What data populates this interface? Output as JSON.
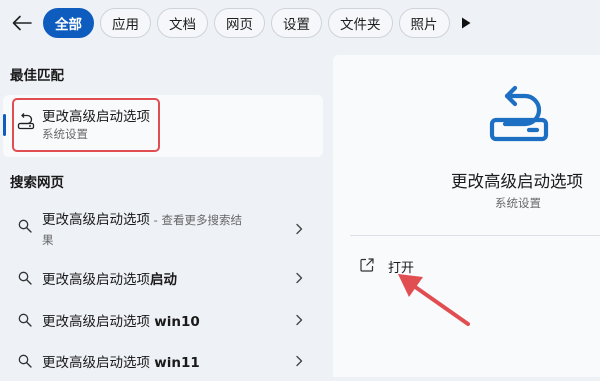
{
  "topbar": {
    "chips": [
      {
        "label": "全部",
        "active": true
      },
      {
        "label": "应用",
        "active": false
      },
      {
        "label": "文档",
        "active": false
      },
      {
        "label": "网页",
        "active": false
      },
      {
        "label": "设置",
        "active": false
      },
      {
        "label": "文件夹",
        "active": false
      },
      {
        "label": "照片",
        "active": false
      }
    ]
  },
  "best_match": {
    "heading": "最佳匹配",
    "title": "更改高级启动选项",
    "subtitle": "系统设置"
  },
  "web_search": {
    "heading": "搜索网页",
    "items": [
      {
        "label": "更改高级启动选项",
        "suffix": " - 查看更多搜索结",
        "wrap": "果"
      },
      {
        "label": "更改高级启动选项",
        "bold": "启动"
      },
      {
        "label": "更改高级启动选项 ",
        "bold": "win10"
      },
      {
        "label": "更改高级启动选项 ",
        "bold": "win11"
      }
    ]
  },
  "detail": {
    "title": "更改高级启动选项",
    "subtitle": "系统设置",
    "actions": [
      {
        "label": "打开",
        "icon": "open-external-icon"
      }
    ]
  },
  "colors": {
    "accent": "#0f5cbf",
    "highlight": "#e14e52",
    "icon": "#1d6fc4"
  }
}
